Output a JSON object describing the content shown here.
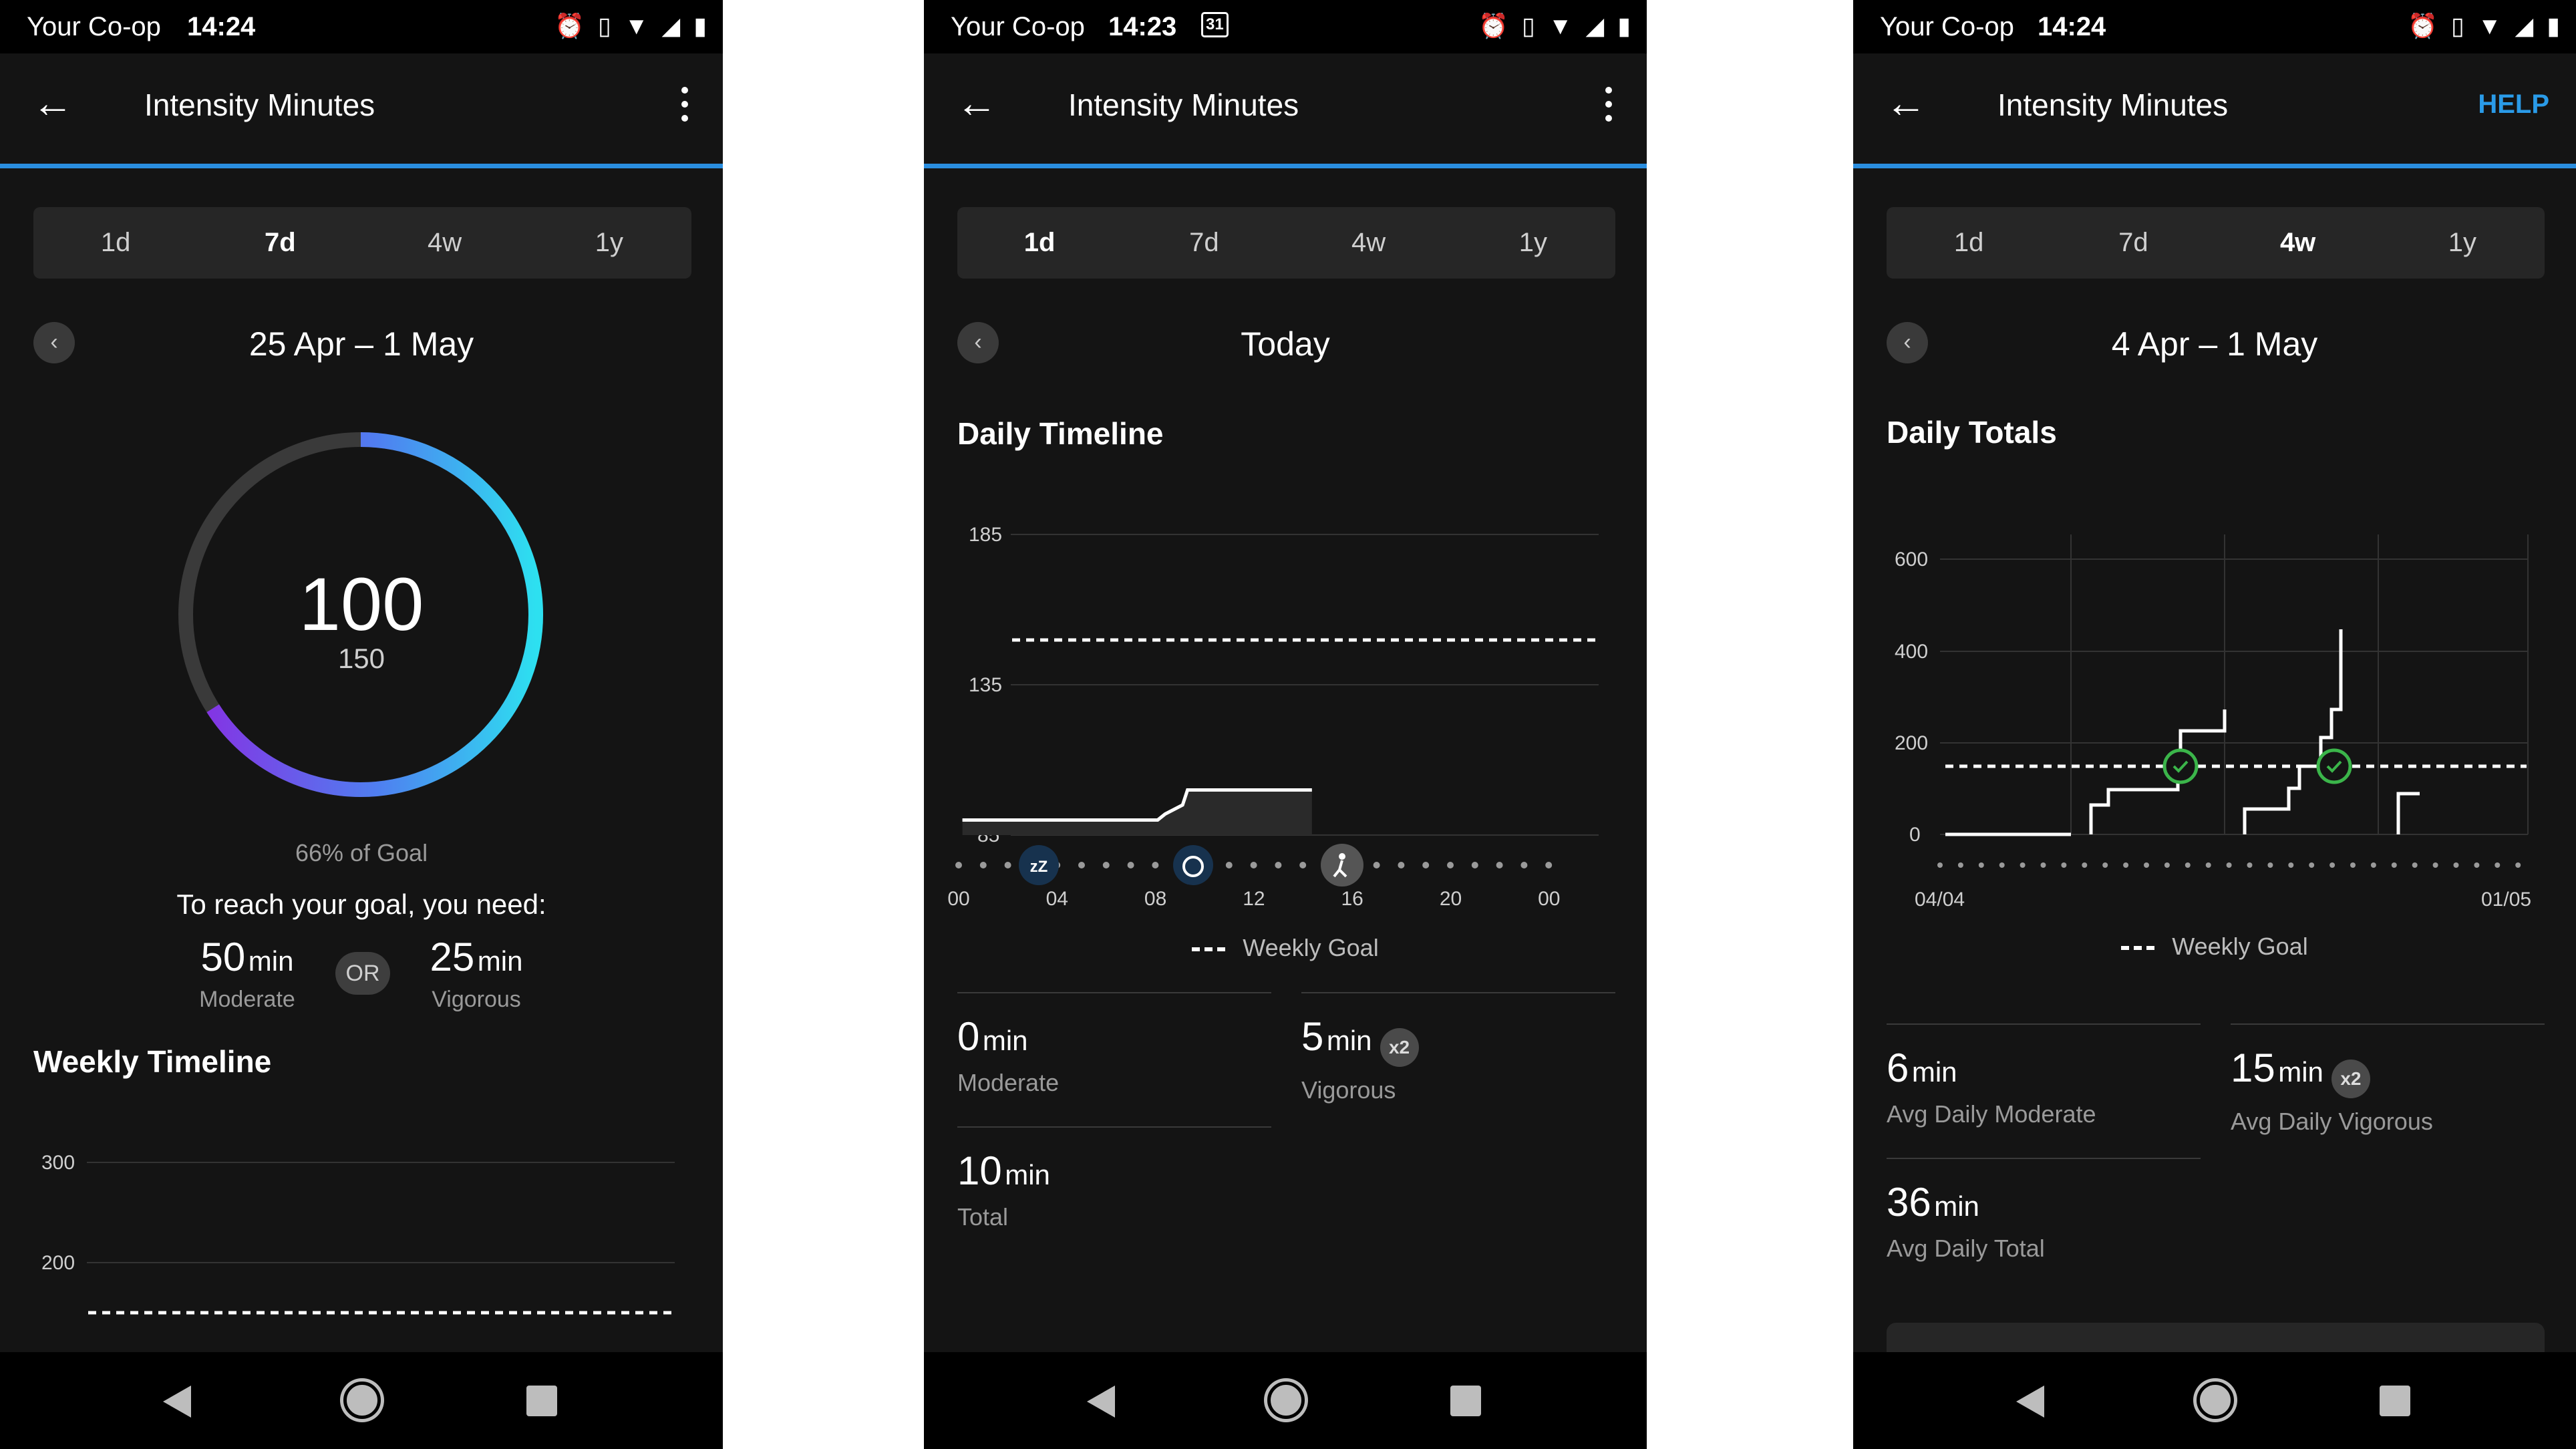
{
  "screens": [
    {
      "carrier": "Your Co-op",
      "time": "14:24",
      "title": "Intensity Minutes",
      "tabs": [
        "1d",
        "7d",
        "4w",
        "1y"
      ],
      "active_tab": "7d",
      "date_range": "25 Apr – 1 May",
      "ring": {
        "value": "100",
        "goal": "150",
        "progress": 0.66
      },
      "percent_of_goal": "66% of Goal",
      "reach_text": "To reach your goal, you need:",
      "option_a": {
        "value": "50",
        "unit": "min",
        "label": "Moderate"
      },
      "or_label": "OR",
      "option_b": {
        "value": "25",
        "unit": "min",
        "label": "Vigorous"
      },
      "section_title": "Weekly Timeline",
      "chart_data": {
        "type": "line",
        "title": "Weekly Timeline",
        "y_ticks": [
          "300",
          "200"
        ],
        "goal": 150
      }
    },
    {
      "carrier": "Your Co-op",
      "time": "14:23",
      "calendar_badge": "31",
      "title": "Intensity Minutes",
      "tabs": [
        "1d",
        "7d",
        "4w",
        "1y"
      ],
      "active_tab": "1d",
      "date_range": "Today",
      "section_title": "Daily Timeline",
      "chart_data": {
        "type": "line",
        "title": "Daily Timeline",
        "y_ticks": [
          "185",
          "135",
          "85"
        ],
        "x_ticks": [
          "00",
          "04",
          "08",
          "12",
          "16",
          "20",
          "00"
        ],
        "ylim": [
          85,
          185
        ],
        "goal": 150,
        "series": [
          {
            "x": [
              0.15,
              8,
              8.3,
              9,
              9.2,
              14.2
            ],
            "values": [
              90,
              90,
              92,
              95,
              100,
              100
            ]
          }
        ],
        "markers": [
          "sleep",
          "alarm",
          "walk"
        ]
      },
      "legend": "Weekly Goal",
      "stats": [
        {
          "value": "0",
          "unit": "min",
          "label": "Moderate"
        },
        {
          "value": "5",
          "unit": "min",
          "label": "Vigorous",
          "badge": "x2"
        },
        {
          "value": "10",
          "unit": "min",
          "label": "Total"
        }
      ]
    },
    {
      "carrier": "Your Co-op",
      "time": "14:24",
      "title": "Intensity Minutes",
      "help": "HELP",
      "tabs": [
        "1d",
        "7d",
        "4w",
        "1y"
      ],
      "active_tab": "4w",
      "date_range": "4 Apr – 1 May",
      "section_title": "Daily Totals",
      "chart_data": {
        "type": "line",
        "title": "Daily Totals",
        "y_ticks": [
          "600",
          "400",
          "200",
          "0"
        ],
        "x_labels": [
          "04/04",
          "01/05"
        ],
        "ylim": [
          0,
          600
        ],
        "goal": 150,
        "goal_reached_markers": 2
      },
      "legend": "Weekly Goal",
      "stats": [
        {
          "value": "6",
          "unit": "min",
          "label": "Avg Daily Moderate"
        },
        {
          "value": "15",
          "unit": "min",
          "label": "Avg Daily Vigorous",
          "badge": "x2"
        },
        {
          "value": "36",
          "unit": "min",
          "label": "Avg Daily Total"
        }
      ]
    }
  ]
}
